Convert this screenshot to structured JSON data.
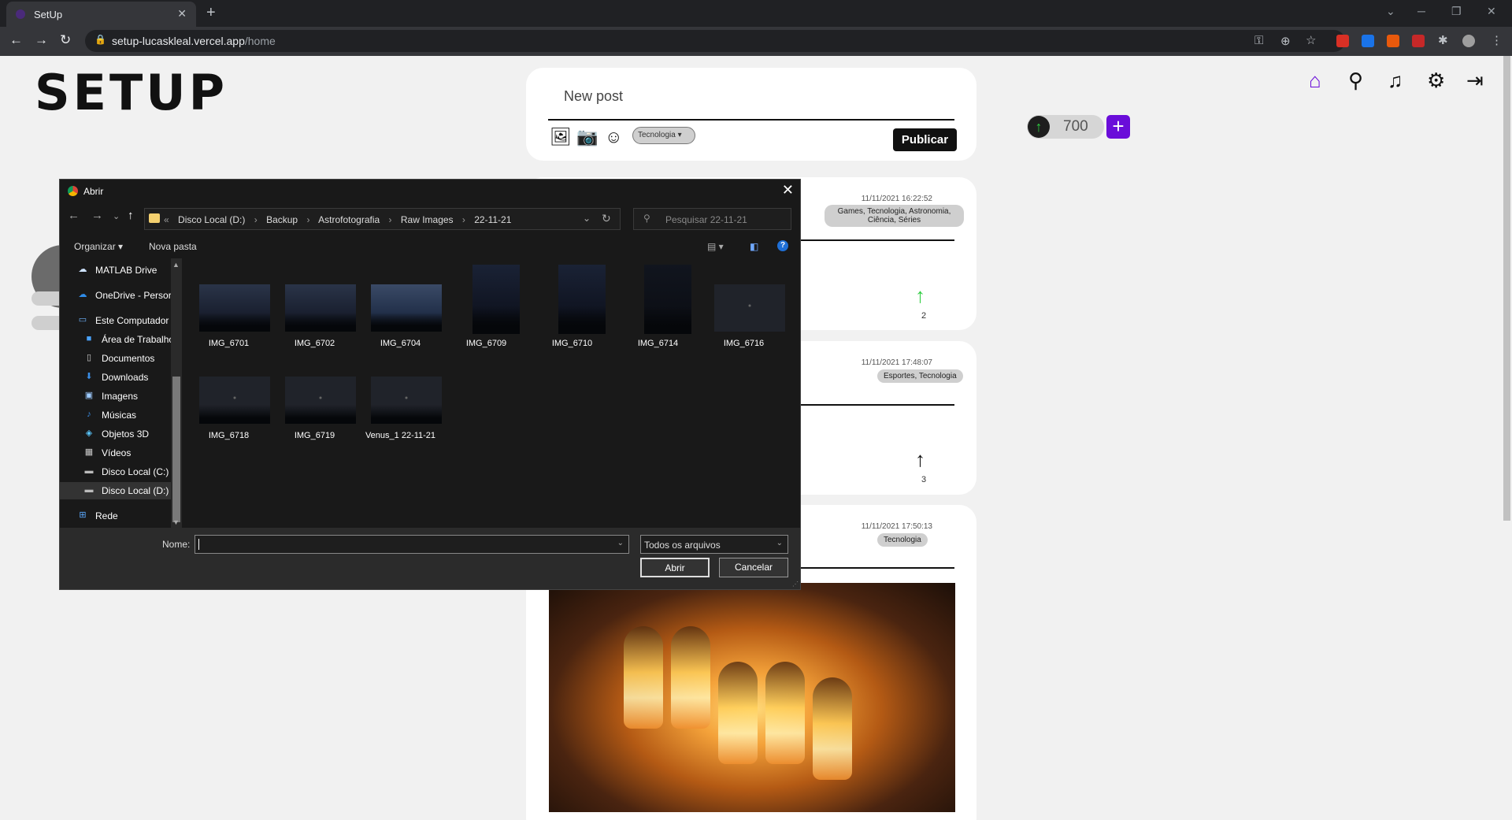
{
  "browser": {
    "tab_title": "SetUp",
    "tab_close": "✕",
    "new_tab": "+",
    "url_host": "setup-lucaskleal.vercel.app",
    "url_path": "/home",
    "lock": "🔒",
    "window_controls": [
      "─",
      "❐",
      "✕"
    ]
  },
  "app": {
    "logo": "SETUP",
    "nav_icons": [
      "home-icon",
      "search-icon",
      "bell-icon",
      "gear-icon",
      "logout-icon"
    ],
    "accent_color": "#6a0dd9",
    "points": "700",
    "plus": "+"
  },
  "new_post": {
    "placeholder": "New post",
    "category": "Tecnologia",
    "publish_label": "Publicar"
  },
  "posts": [
    {
      "date": "11/11/2021 16:22:52",
      "tags": "Games, Tecnologia, Astronomia, Ciência, Séries",
      "votes": "2",
      "upvoted": true
    },
    {
      "date": "11/11/2021 17:48:07",
      "tags": "Esportes, Tecnologia",
      "votes": "3",
      "upvoted": false
    },
    {
      "date": "11/11/2021 17:50:13",
      "tags": "Tecnologia"
    }
  ],
  "dialog": {
    "title": "Abrir",
    "close": "✕",
    "breadcrumb": [
      "«",
      "Disco Local (D:)",
      "›",
      "Backup",
      "›",
      "Astrofotografia",
      "›",
      "Raw Images",
      "›",
      "22-11-21"
    ],
    "search_placeholder": "Pesquisar 22-11-21",
    "organize": "Organizar ▾",
    "new_folder": "Nova pasta",
    "nav_items": [
      {
        "label": "MATLAB Drive",
        "icon": "cloud-icon"
      },
      {
        "label": "OneDrive - Persor",
        "icon": "onedrive-icon"
      },
      {
        "label": "Este Computador",
        "icon": "computer-icon"
      },
      {
        "label": "Área de Trabalhc",
        "icon": "desktop-icon"
      },
      {
        "label": "Documentos",
        "icon": "document-icon"
      },
      {
        "label": "Downloads",
        "icon": "download-icon"
      },
      {
        "label": "Imagens",
        "icon": "image-icon"
      },
      {
        "label": "Músicas",
        "icon": "music-icon"
      },
      {
        "label": "Objetos 3D",
        "icon": "cube-icon"
      },
      {
        "label": "Vídeos",
        "icon": "video-icon"
      },
      {
        "label": "Disco Local (C:)",
        "icon": "drive-icon"
      },
      {
        "label": "Disco Local (D:)",
        "icon": "drive-icon",
        "selected": true
      },
      {
        "label": "Rede",
        "icon": "network-icon"
      }
    ],
    "files": [
      "IMG_6701",
      "IMG_6702",
      "IMG_6704",
      "IMG_6709",
      "IMG_6710",
      "IMG_6714",
      "IMG_6716",
      "IMG_6718",
      "IMG_6719",
      "Venus_1 22-11-21"
    ],
    "name_label": "Nome:",
    "name_value": "",
    "filetype": "Todos os arquivos",
    "open_label": "Abrir",
    "cancel_label": "Cancelar"
  }
}
